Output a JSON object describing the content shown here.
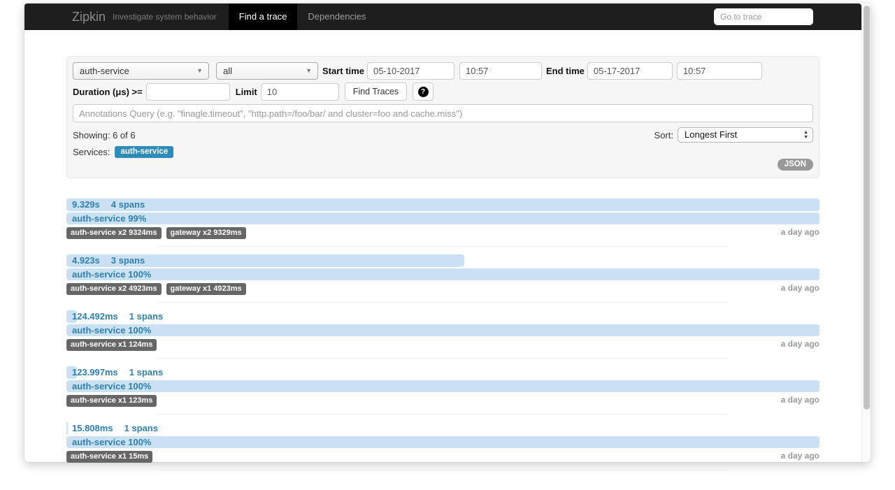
{
  "navbar": {
    "brand": "Zipkin",
    "tagline": "Investigate system behavior",
    "tabs": [
      {
        "label": "Find a trace",
        "active": true
      },
      {
        "label": "Dependencies",
        "active": false
      }
    ],
    "goto_trace_placeholder": "Go to trace"
  },
  "filters": {
    "service_selected": "auth-service",
    "span_selected": "all",
    "start_time_label": "Start time",
    "start_date": "05-10-2017",
    "start_clock": "10:57",
    "end_time_label": "End time",
    "end_date": "05-17-2017",
    "end_clock": "10:57",
    "duration_label": "Duration (μs) >=",
    "duration_value": "",
    "limit_label": "Limit",
    "limit_value": "10",
    "find_button_label": "Find Traces",
    "help_icon_glyph": "?",
    "annotations_placeholder": "Annotations Query (e.g. \"finagle.timeout\", \"http.path=/foo/bar/ and cluster=foo and cache.miss\")"
  },
  "results": {
    "showing_text": "Showing: 6 of 6",
    "sort_label": "Sort:",
    "sort_value": "Longest First",
    "services_label": "Services:",
    "service_badges": [
      "auth-service"
    ],
    "json_button_label": "JSON"
  },
  "traces": [
    {
      "duration": "9.329s",
      "spans": "4 spans",
      "duration_pct": 100,
      "service_summary": "auth-service 99%",
      "tags": [
        "auth-service x2 9324ms",
        "gateway x2 9329ms"
      ],
      "age": "a day ago"
    },
    {
      "duration": "4.923s",
      "spans": "3 spans",
      "duration_pct": 52.8,
      "service_summary": "auth-service 100%",
      "tags": [
        "auth-service x2 4923ms",
        "gateway x1 4923ms"
      ],
      "age": "a day ago"
    },
    {
      "duration": "124.492ms",
      "spans": "1 spans",
      "duration_pct": 1.35,
      "service_summary": "auth-service 100%",
      "tags": [
        "auth-service x1 124ms"
      ],
      "age": "a day ago"
    },
    {
      "duration": "123.997ms",
      "spans": "1 spans",
      "duration_pct": 1.35,
      "service_summary": "auth-service 100%",
      "tags": [
        "auth-service x1 123ms"
      ],
      "age": "a day ago"
    },
    {
      "duration": "15.808ms",
      "spans": "1 spans",
      "duration_pct": 0.2,
      "service_summary": "auth-service 100%",
      "tags": [
        "auth-service x1 15ms"
      ],
      "age": "a day ago"
    }
  ],
  "colors": {
    "navbar_bg": "#1e1e1e",
    "active_tab_bg": "#000000",
    "trace_bar": "#c9e1f2",
    "trace_text": "#2e7fb2",
    "service_badge": "#2f8cb8",
    "tag_badge": "#666666",
    "json_pill": "#999999"
  }
}
